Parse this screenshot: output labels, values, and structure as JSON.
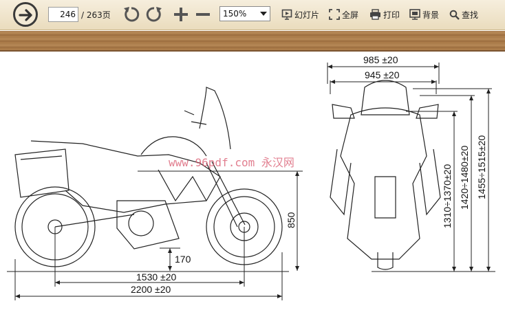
{
  "toolbar": {
    "page_current": "246",
    "page_total": "/ 263页",
    "zoom": "150%",
    "slideshow_label": "幻灯片",
    "fullscreen_label": "全屏",
    "print_label": "打印",
    "background_label": "背景",
    "search_label": "查找",
    "icons": [
      "next-page-icon",
      "rotate-left-icon",
      "rotate-right-icon",
      "zoom-in-icon",
      "zoom-out-icon",
      "slideshow-icon",
      "fullscreen-icon",
      "print-icon",
      "background-icon",
      "search-icon"
    ]
  },
  "drawing": {
    "watermark": "www.96pdf.com 永汉网",
    "dims": {
      "width_985": "985 ±20",
      "width_945": "945 ±20",
      "height_1310": "1310÷1370±20",
      "height_1420": "1420÷1480±20",
      "height_1455": "1455÷1515±20",
      "seat_850": "850",
      "ground_170": "170",
      "wheelbase": "1530 ±20",
      "length": "2200 ±20"
    }
  },
  "colors": {
    "toolbar_bg": "#eadcbd",
    "wood": "#a7794a",
    "watermark": "#d8546a"
  }
}
